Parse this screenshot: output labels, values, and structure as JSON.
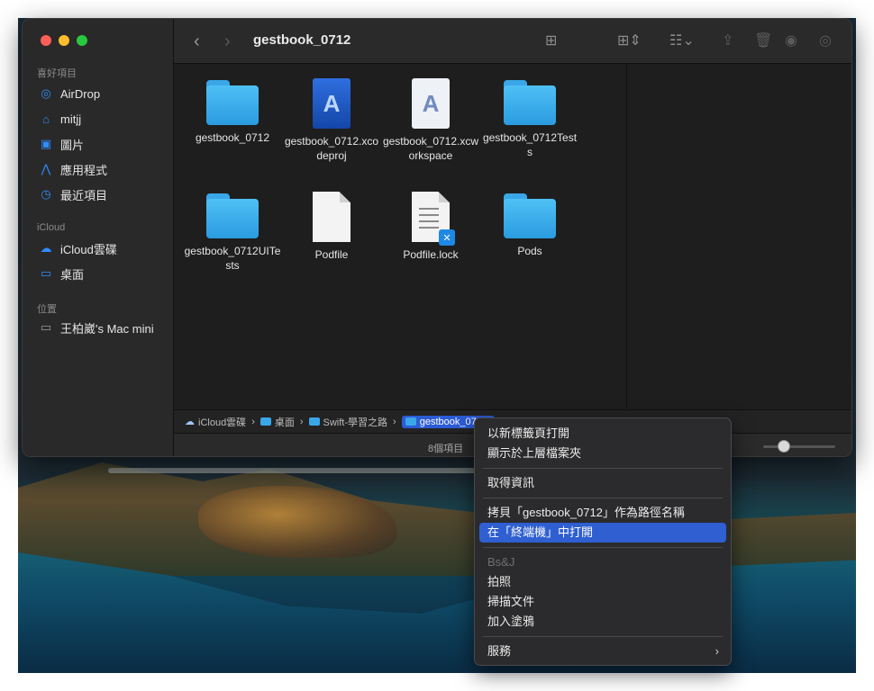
{
  "window": {
    "title": "gestbook_0712"
  },
  "sidebar": {
    "favorites_label": "喜好項目",
    "favorites": [
      {
        "label": "AirDrop",
        "icon": "airdrop-icon"
      },
      {
        "label": "mitjj",
        "icon": "home-icon"
      },
      {
        "label": "圖片",
        "icon": "photos-icon"
      },
      {
        "label": "應用程式",
        "icon": "applications-icon"
      },
      {
        "label": "最近項目",
        "icon": "recents-icon"
      }
    ],
    "icloud_label": "iCloud",
    "icloud": [
      {
        "label": "iCloud雲碟",
        "icon": "cloud-icon"
      },
      {
        "label": "桌面",
        "icon": "desktop-icon"
      }
    ],
    "locations_label": "位置",
    "locations": [
      {
        "label": "王柏崴's Mac mini",
        "icon": "computer-icon"
      }
    ]
  },
  "files": [
    {
      "name": "gestbook_0712",
      "kind": "folder"
    },
    {
      "name": "gestbook_0712.xcodeproj",
      "kind": "xcodeproj"
    },
    {
      "name": "gestbook_0712.xcworkspace",
      "kind": "xcworkspace"
    },
    {
      "name": "gestbook_0712Tests",
      "kind": "folder"
    },
    {
      "name": "gestbook_0712UITests",
      "kind": "folder"
    },
    {
      "name": "Podfile",
      "kind": "document"
    },
    {
      "name": "Podfile.lock",
      "kind": "vscode-document"
    },
    {
      "name": "Pods",
      "kind": "folder"
    }
  ],
  "pathbar": {
    "crumbs": [
      "iCloud雲碟",
      "桌面",
      "Swift-學習之路",
      "gestbook_0712"
    ]
  },
  "status": {
    "item_count": "8個項目"
  },
  "context_menu": {
    "items": [
      "以新標籤頁打開",
      "顯示於上層檔案夾",
      "取得資訊",
      "拷貝「gestbook_0712」作為路徑名稱",
      "在「終端機」中打開",
      "Bs&J",
      "拍照",
      "掃描文件",
      "加入塗鴉",
      "服務"
    ],
    "highlighted": "在「終端機」中打開"
  },
  "colors": {
    "accent": "#2f5fd1",
    "folder_blue": "#3aa6e8"
  }
}
